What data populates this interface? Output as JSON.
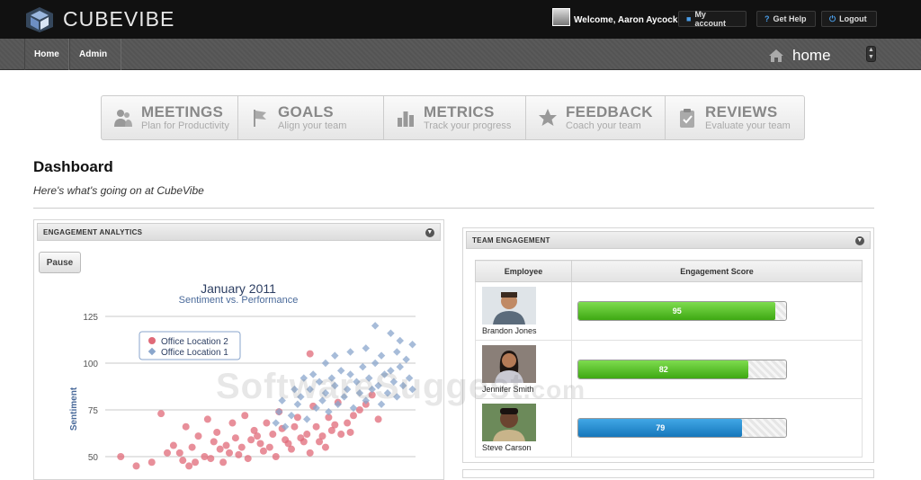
{
  "app": {
    "brand": "CUBEVIBE"
  },
  "topbar": {
    "welcome": "Welcome, Aaron Aycock",
    "my_account": "My account",
    "get_help": "Get Help",
    "logout": "Logout"
  },
  "nav": {
    "home": "Home",
    "admin": "Admin",
    "page": "home"
  },
  "features": [
    {
      "title": "MEETINGS",
      "sub": "Plan for Productivity",
      "icon": "people-icon"
    },
    {
      "title": "GOALS",
      "sub": "Align your team",
      "icon": "flag-icon"
    },
    {
      "title": "METRICS",
      "sub": "Track your progress",
      "icon": "bar-chart-icon"
    },
    {
      "title": "FEEDBACK",
      "sub": "Coach your team",
      "icon": "star-icon"
    },
    {
      "title": "REVIEWS",
      "sub": "Evaluate your team",
      "icon": "clipboard-icon"
    }
  ],
  "dashboard": {
    "title": "Dashboard",
    "subtitle": "Here's what's going on at CubeVibe"
  },
  "engagement_analytics": {
    "header": "ENGAGEMENT ANALYTICS",
    "pause": "Pause"
  },
  "chart_data": {
    "type": "scatter",
    "title": "January 2011",
    "subtitle": "Sentiment vs. Performance",
    "ylabel": "Sentiment",
    "xlabel": "",
    "yticks": [
      125,
      100,
      75,
      50
    ],
    "ylim": [
      45,
      130
    ],
    "xlim": [
      0,
      100
    ],
    "legend_position": "top-left",
    "series": [
      {
        "name": "Office Location 2",
        "color": "#e06a78",
        "marker": "circle",
        "points": [
          [
            5,
            50
          ],
          [
            10,
            45
          ],
          [
            15,
            47
          ],
          [
            18,
            73
          ],
          [
            20,
            52
          ],
          [
            22,
            56
          ],
          [
            25,
            48
          ],
          [
            26,
            66
          ],
          [
            28,
            55
          ],
          [
            30,
            61
          ],
          [
            32,
            50
          ],
          [
            33,
            70
          ],
          [
            35,
            58
          ],
          [
            36,
            63
          ],
          [
            38,
            47
          ],
          [
            40,
            52
          ],
          [
            41,
            68
          ],
          [
            42,
            60
          ],
          [
            44,
            55
          ],
          [
            45,
            72
          ],
          [
            46,
            49
          ],
          [
            48,
            64
          ],
          [
            50,
            57
          ],
          [
            51,
            53
          ],
          [
            52,
            68
          ],
          [
            54,
            62
          ],
          [
            55,
            50
          ],
          [
            56,
            74
          ],
          [
            58,
            59
          ],
          [
            60,
            54
          ],
          [
            61,
            66
          ],
          [
            62,
            71
          ],
          [
            64,
            58
          ],
          [
            65,
            62
          ],
          [
            66,
            52
          ],
          [
            67,
            77
          ],
          [
            68,
            66
          ],
          [
            70,
            61
          ],
          [
            71,
            55
          ],
          [
            72,
            71
          ],
          [
            73,
            64
          ],
          [
            75,
            79
          ],
          [
            76,
            62
          ],
          [
            78,
            68
          ],
          [
            80,
            72
          ],
          [
            82,
            75
          ],
          [
            84,
            78
          ],
          [
            86,
            83
          ],
          [
            24,
            52
          ],
          [
            29,
            47
          ],
          [
            37,
            54
          ],
          [
            43,
            51
          ],
          [
            47,
            59
          ],
          [
            53,
            55
          ],
          [
            57,
            65
          ],
          [
            63,
            60
          ],
          [
            69,
            58
          ],
          [
            74,
            67
          ],
          [
            79,
            63
          ],
          [
            27,
            45
          ],
          [
            34,
            49
          ],
          [
            39,
            56
          ],
          [
            49,
            61
          ],
          [
            59,
            57
          ],
          [
            66,
            105
          ],
          [
            88,
            70
          ]
        ]
      },
      {
        "name": "Office Location 1",
        "color": "#8aa6cc",
        "marker": "diamond",
        "points": [
          [
            60,
            72
          ],
          [
            62,
            78
          ],
          [
            63,
            82
          ],
          [
            65,
            70
          ],
          [
            66,
            86
          ],
          [
            68,
            76
          ],
          [
            69,
            90
          ],
          [
            70,
            80
          ],
          [
            71,
            84
          ],
          [
            72,
            74
          ],
          [
            73,
            92
          ],
          [
            74,
            88
          ],
          [
            75,
            78
          ],
          [
            76,
            96
          ],
          [
            77,
            82
          ],
          [
            78,
            86
          ],
          [
            79,
            94
          ],
          [
            80,
            76
          ],
          [
            81,
            90
          ],
          [
            82,
            84
          ],
          [
            83,
            98
          ],
          [
            84,
            80
          ],
          [
            85,
            92
          ],
          [
            86,
            86
          ],
          [
            87,
            100
          ],
          [
            88,
            88
          ],
          [
            89,
            78
          ],
          [
            90,
            94
          ],
          [
            91,
            84
          ],
          [
            92,
            96
          ],
          [
            93,
            90
          ],
          [
            94,
            82
          ],
          [
            95,
            98
          ],
          [
            96,
            88
          ],
          [
            97,
            102
          ],
          [
            98,
            92
          ],
          [
            99,
            86
          ],
          [
            67,
            94
          ],
          [
            71,
            100
          ],
          [
            74,
            104
          ],
          [
            79,
            106
          ],
          [
            84,
            108
          ],
          [
            89,
            104
          ],
          [
            94,
            106
          ],
          [
            99,
            110
          ],
          [
            92,
            116
          ],
          [
            61,
            86
          ],
          [
            64,
            92
          ],
          [
            57,
            80
          ],
          [
            56,
            74
          ],
          [
            55,
            68
          ],
          [
            58,
            66
          ],
          [
            87,
            120
          ],
          [
            95,
            112
          ]
        ]
      }
    ]
  },
  "team_engagement": {
    "header": "TEAM ENGAGEMENT",
    "col_employee": "Employee",
    "col_score": "Engagement Score",
    "rows": [
      {
        "name": "Brandon Jones",
        "score": 95,
        "bar_color": "green"
      },
      {
        "name": "Jennifer Smith",
        "score": 82,
        "bar_color": "green"
      },
      {
        "name": "Steve Carson",
        "score": 79,
        "bar_color": "blue"
      }
    ]
  },
  "watermark": {
    "main": "SoftwareSuggest",
    "suffix": ".com"
  }
}
